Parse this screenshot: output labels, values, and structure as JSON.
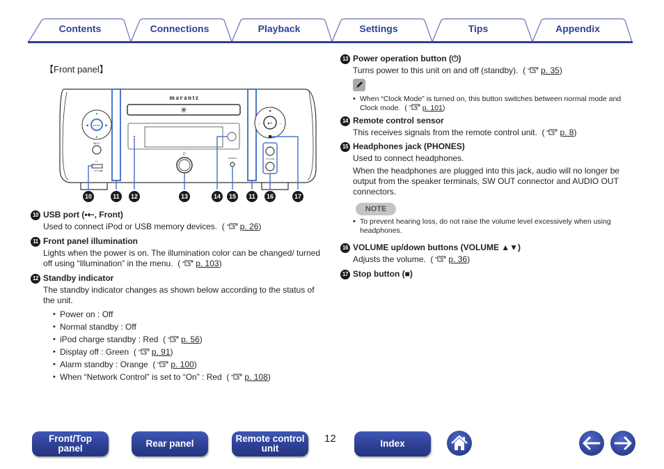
{
  "tabs": [
    {
      "label": "Contents"
    },
    {
      "label": "Connections"
    },
    {
      "label": "Playback"
    },
    {
      "label": "Settings"
    },
    {
      "label": "Tips"
    },
    {
      "label": "Appendix"
    }
  ],
  "section_label": "【Front panel】",
  "device": {
    "brand": "marantz",
    "callouts": [
      "10",
      "11",
      "12",
      "13",
      "14",
      "15",
      "11",
      "16",
      "17"
    ]
  },
  "items": [
    {
      "num": "10",
      "title": "USB port (•⇠, Front)",
      "text": "Used to connect iPod or USB memory devices.",
      "ref": "p. 26"
    },
    {
      "num": "11",
      "title": "Front panel illumination",
      "text": "Lights when the power is on. The illumination color can be changed/ turned off using “Illumination” in the menu.",
      "ref": "p. 103"
    },
    {
      "num": "12",
      "title": "Standby indicator",
      "text": "The standby indicator changes as shown below according to the status of the unit.",
      "bullets": [
        {
          "text": "Power on : Off",
          "ref": ""
        },
        {
          "text": "Normal standby : Off",
          "ref": ""
        },
        {
          "text": "iPod charge standby : Red",
          "ref": "p. 56"
        },
        {
          "text": "Display off : Green",
          "ref": "p. 91"
        },
        {
          "text": "Alarm standby : Orange",
          "ref": "p. 100"
        },
        {
          "text": "When “Network Control” is set to “On” : Red",
          "ref": "p. 108"
        }
      ]
    },
    {
      "num": "13",
      "title": "Power operation button (⏻)",
      "text": "Turns power to this unit on and off (standby).",
      "ref": "p. 35",
      "memo": {
        "text": "When “Clock Mode” is turned on, this button switches between normal mode and Clock mode.",
        "ref": "p. 101"
      }
    },
    {
      "num": "14",
      "title": "Remote control sensor",
      "text": "This receives signals from the remote control unit.",
      "ref": "p. 8"
    },
    {
      "num": "15",
      "title": "Headphones jack (PHONES)",
      "text": "Used to connect headphones.",
      "text2": "When the headphones are plugged into this jack, audio will no longer be output from the speaker terminals, SW OUT connector and AUDIO OUT connectors.",
      "note_label": "NOTE",
      "note": "To prevent hearing loss, do not raise the volume level excessively when using headphones."
    },
    {
      "num": "16",
      "title": "VOLUME up/down buttons (VOLUME ▲▼)",
      "text": "Adjusts the volume.",
      "ref": "p. 36"
    },
    {
      "num": "17",
      "title": "Stop button (■)"
    }
  ],
  "footer": {
    "front_top": "Front/Top panel",
    "rear_panel": "Rear panel",
    "remote_control": "Remote control unit",
    "page_number": "12",
    "index": "Index",
    "home_icon": "home-icon",
    "prev_icon": "arrow-left-icon",
    "next_icon": "arrow-right-icon"
  },
  "colors": {
    "brand_blue": "#2f4191",
    "tab_outline": "#6b6fb8",
    "illumination_blue": "#4b78c8"
  }
}
